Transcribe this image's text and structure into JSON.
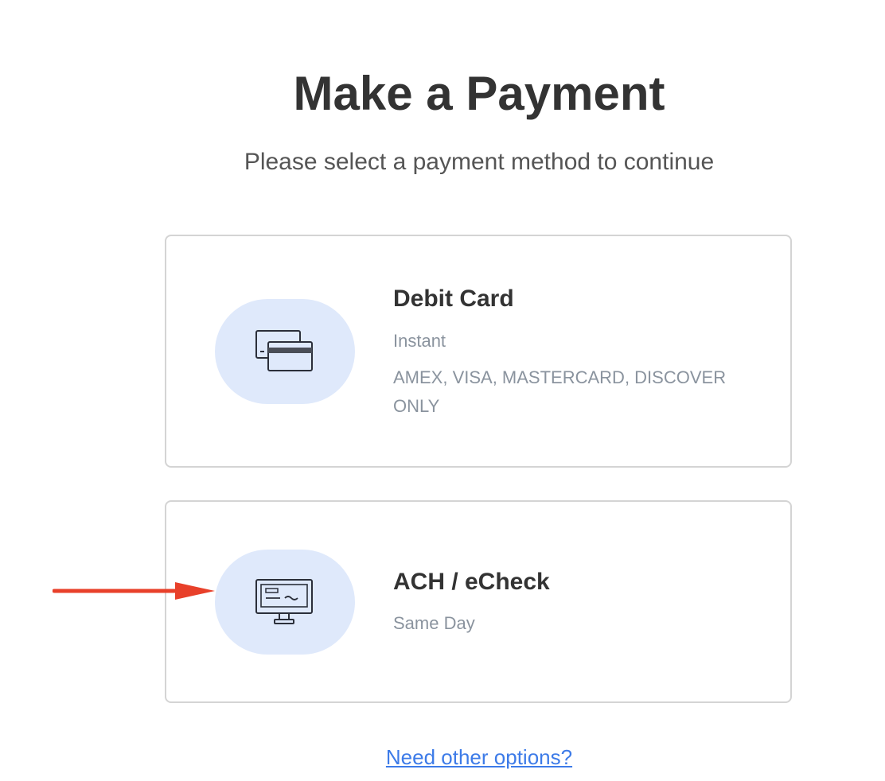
{
  "header": {
    "title": "Make a Payment",
    "subtitle": "Please select a payment method to continue"
  },
  "methods": [
    {
      "title": "Debit Card",
      "speed": "Instant",
      "note": "AMEX, VISA, MASTERCARD, DISCOVER ONLY",
      "icon": "credit-cards-icon"
    },
    {
      "title": "ACH / eCheck",
      "speed": "Same Day",
      "icon": "monitor-check-icon"
    }
  ],
  "footer": {
    "other_options_link": "Need other options?"
  },
  "colors": {
    "icon_background": "#dfe9fb",
    "link": "#3d7be8",
    "muted_text": "#8a939e",
    "annotation_arrow": "#e8402a"
  }
}
